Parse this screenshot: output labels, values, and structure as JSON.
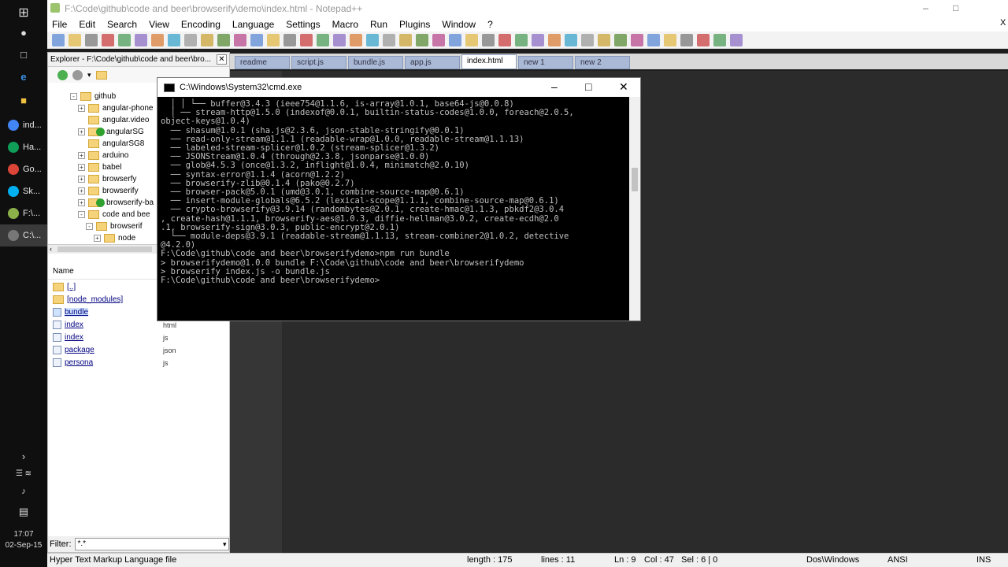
{
  "taskbar": {
    "items": [
      {
        "label": "ind...",
        "color": "#4285f4"
      },
      {
        "label": "Ha...",
        "color": "#0f9d58"
      },
      {
        "label": "Go...",
        "color": "#db4437"
      },
      {
        "label": "Sk...",
        "color": "#00aff0"
      },
      {
        "label": "F:\\...",
        "color": "#8bb04a"
      },
      {
        "label": "C:\\...",
        "color": "#777777"
      }
    ],
    "clock_time": "17:07",
    "clock_date": "02-Sep-15"
  },
  "npp": {
    "title": "F:\\Code\\github\\code and beer\\browserify\\demo\\index.html - Notepad++",
    "menu": [
      "File",
      "Edit",
      "Search",
      "View",
      "Encoding",
      "Language",
      "Settings",
      "Macro",
      "Run",
      "Plugins",
      "Window",
      "?"
    ],
    "close_glyph": "X"
  },
  "explorer": {
    "title": "Explorer - F:\\Code\\github\\code and beer\\bro...",
    "tree": [
      {
        "label": "github",
        "indent": 1,
        "exp": "-"
      },
      {
        "label": "angular-phone",
        "indent": 2,
        "exp": "+"
      },
      {
        "label": "angular.video",
        "indent": 2,
        "exp": ""
      },
      {
        "label": "angularSG",
        "indent": 2,
        "exp": "+",
        "check": true
      },
      {
        "label": "angularSG8",
        "indent": 2,
        "exp": ""
      },
      {
        "label": "arduino",
        "indent": 2,
        "exp": "+"
      },
      {
        "label": "babel",
        "indent": 2,
        "exp": "+"
      },
      {
        "label": "browserfy",
        "indent": 2,
        "exp": "+"
      },
      {
        "label": "browserify",
        "indent": 2,
        "exp": "+"
      },
      {
        "label": "browserify-ba",
        "indent": 2,
        "exp": "+",
        "check": true
      },
      {
        "label": "code and bee",
        "indent": 2,
        "exp": "-"
      },
      {
        "label": "browserif",
        "indent": 3,
        "exp": "-"
      },
      {
        "label": "node",
        "indent": 4,
        "exp": "+"
      }
    ],
    "name_header": "Name",
    "files": [
      {
        "name": "[..]",
        "ext": ""
      },
      {
        "name": "[node_modules]",
        "ext": ""
      },
      {
        "name": "bundle",
        "ext": ""
      },
      {
        "name": "index",
        "ext": "html"
      },
      {
        "name": "index",
        "ext": "js"
      },
      {
        "name": "package",
        "ext": "json"
      },
      {
        "name": "persona",
        "ext": "js"
      }
    ],
    "filter_label": "Filter:",
    "filter_value": "*.*"
  },
  "tabs": [
    {
      "label": "readme"
    },
    {
      "label": "script.js"
    },
    {
      "label": "bundle.js"
    },
    {
      "label": "app.js"
    },
    {
      "label": "index.html",
      "active": true
    },
    {
      "label": "new 1"
    },
    {
      "label": "new 2"
    }
  ],
  "cmd": {
    "title": "C:\\Windows\\System32\\cmd.exe",
    "lines": [
      "  │ │ └── buffer@3.4.3 (ieee754@1.1.6, is-array@1.0.1, base64-js@0.0.8)",
      "  │ ── stream-http@1.5.0 (indexof@0.0.1, builtin-status-codes@1.0.0, foreach@2.0.5,",
      "object-keys@1.0.4)",
      "  ── shasum@1.0.1 (sha.js@2.3.6, json-stable-stringify@0.0.1)",
      "  ── read-only-stream@1.1.1 (readable-wrap@1.0.0, readable-stream@1.1.13)",
      "  ── labeled-stream-splicer@1.0.2 (stream-splicer@1.3.2)",
      "  ── JSONStream@1.0.4 (through@2.3.8, jsonparse@1.0.0)",
      "  ── glob@4.5.3 (once@1.3.2, inflight@1.0.4, minimatch@2.0.10)",
      "  ── syntax-error@1.1.4 (acorn@1.2.2)",
      "  ── browserify-zlib@0.1.4 (pako@0.2.7)",
      "  ── browser-pack@5.0.1 (umd@3.0.1, combine-source-map@0.6.1)",
      "  ── insert-module-globals@6.5.2 (lexical-scope@1.1.1, combine-source-map@0.6.1)",
      "  ── crypto-browserify@3.9.14 (randombytes@2.0.1, create-hmac@1.1.3, pbkdf2@3.0.4",
      ", create-hash@1.1.1, browserify-aes@1.0.3, diffie-hellman@3.0.2, create-ecdh@2.0",
      ".1, browserify-sign@3.0.3, public-encrypt@2.0.1)",
      "  └── module-deps@3.9.1 (readable-stream@1.1.13, stream-combiner2@1.0.2, detective",
      "@4.2.0)",
      "",
      "F:\\Code\\github\\code and beer\\browserifydemo>npm run bundle",
      "",
      "> browserifydemo@1.0.0 bundle F:\\Code\\github\\code and beer\\browserifydemo",
      "> browserify index.js -o bundle.js",
      "",
      "",
      "F:\\Code\\github\\code and beer\\browserifydemo>"
    ]
  },
  "status": {
    "file_type": "Hyper Text Markup Language file",
    "length": "length : 175",
    "lines": "lines : 11",
    "ln": "Ln : 9",
    "col": "Col : 47",
    "sel": "Sel : 6 | 0",
    "eol": "Dos\\Windows",
    "encoding": "ANSI",
    "mode": "INS"
  }
}
